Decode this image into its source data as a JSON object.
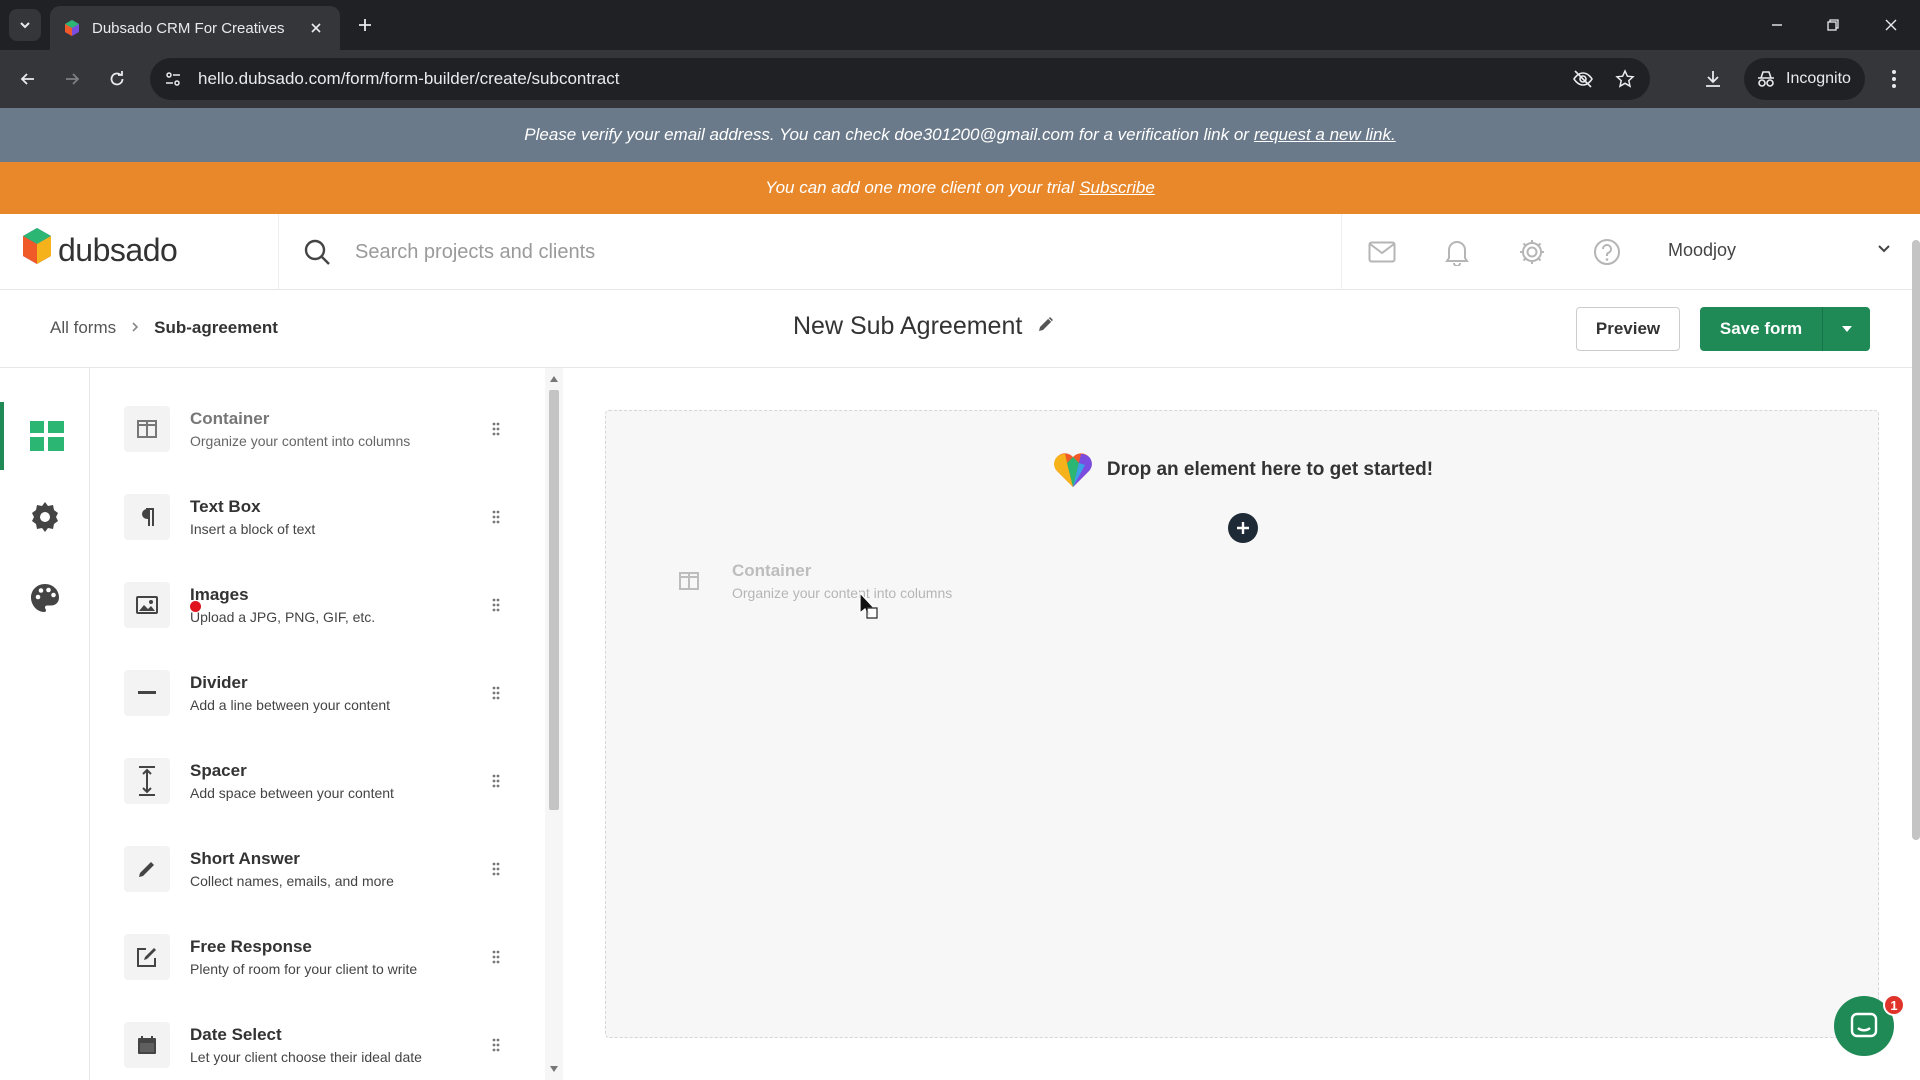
{
  "browser": {
    "tab_title": "Dubsado CRM For Creatives",
    "url": "hello.dubsado.com/form/form-builder/create/subcontract",
    "incognito_label": "Incognito"
  },
  "banners": {
    "verify_text": "Please verify your email address. You can check doe301200@gmail.com for a verification link or",
    "verify_link": "request a new link.",
    "trial_text": "You can add one more client on your trial",
    "trial_link": "Subscribe"
  },
  "header": {
    "logo_text": "dubsado",
    "search_placeholder": "Search projects and clients",
    "user_name": "Moodjoy"
  },
  "subheader": {
    "breadcrumb_root": "All forms",
    "breadcrumb_current": "Sub-agreement",
    "form_title": "New Sub Agreement",
    "preview_label": "Preview",
    "save_label": "Save form"
  },
  "elements": [
    {
      "title": "Container",
      "desc": "Organize your content into columns",
      "icon": "columns-icon"
    },
    {
      "title": "Text Box",
      "desc": "Insert a block of text",
      "icon": "paragraph-icon"
    },
    {
      "title": "Images",
      "desc": "Upload a JPG, PNG, GIF, etc.",
      "icon": "image-icon"
    },
    {
      "title": "Divider",
      "desc": "Add a line between your content",
      "icon": "divider-icon"
    },
    {
      "title": "Spacer",
      "desc": "Add space between your content",
      "icon": "spacer-icon"
    },
    {
      "title": "Short Answer",
      "desc": "Collect names, emails, and more",
      "icon": "pencil-icon"
    },
    {
      "title": "Free Response",
      "desc": "Plenty of room for your client to write",
      "icon": "edit-box-icon"
    },
    {
      "title": "Date Select",
      "desc": "Let your client choose their ideal date",
      "icon": "calendar-icon"
    }
  ],
  "canvas": {
    "drop_message": "Drop an element here to get started!",
    "ghost_title": "Container",
    "ghost_desc": "Organize your content into columns"
  },
  "chat": {
    "badge_count": "1"
  },
  "colors": {
    "accent": "#1f8a55",
    "trial_banner": "#e8882b",
    "verify_banner": "#6b7a8a"
  }
}
